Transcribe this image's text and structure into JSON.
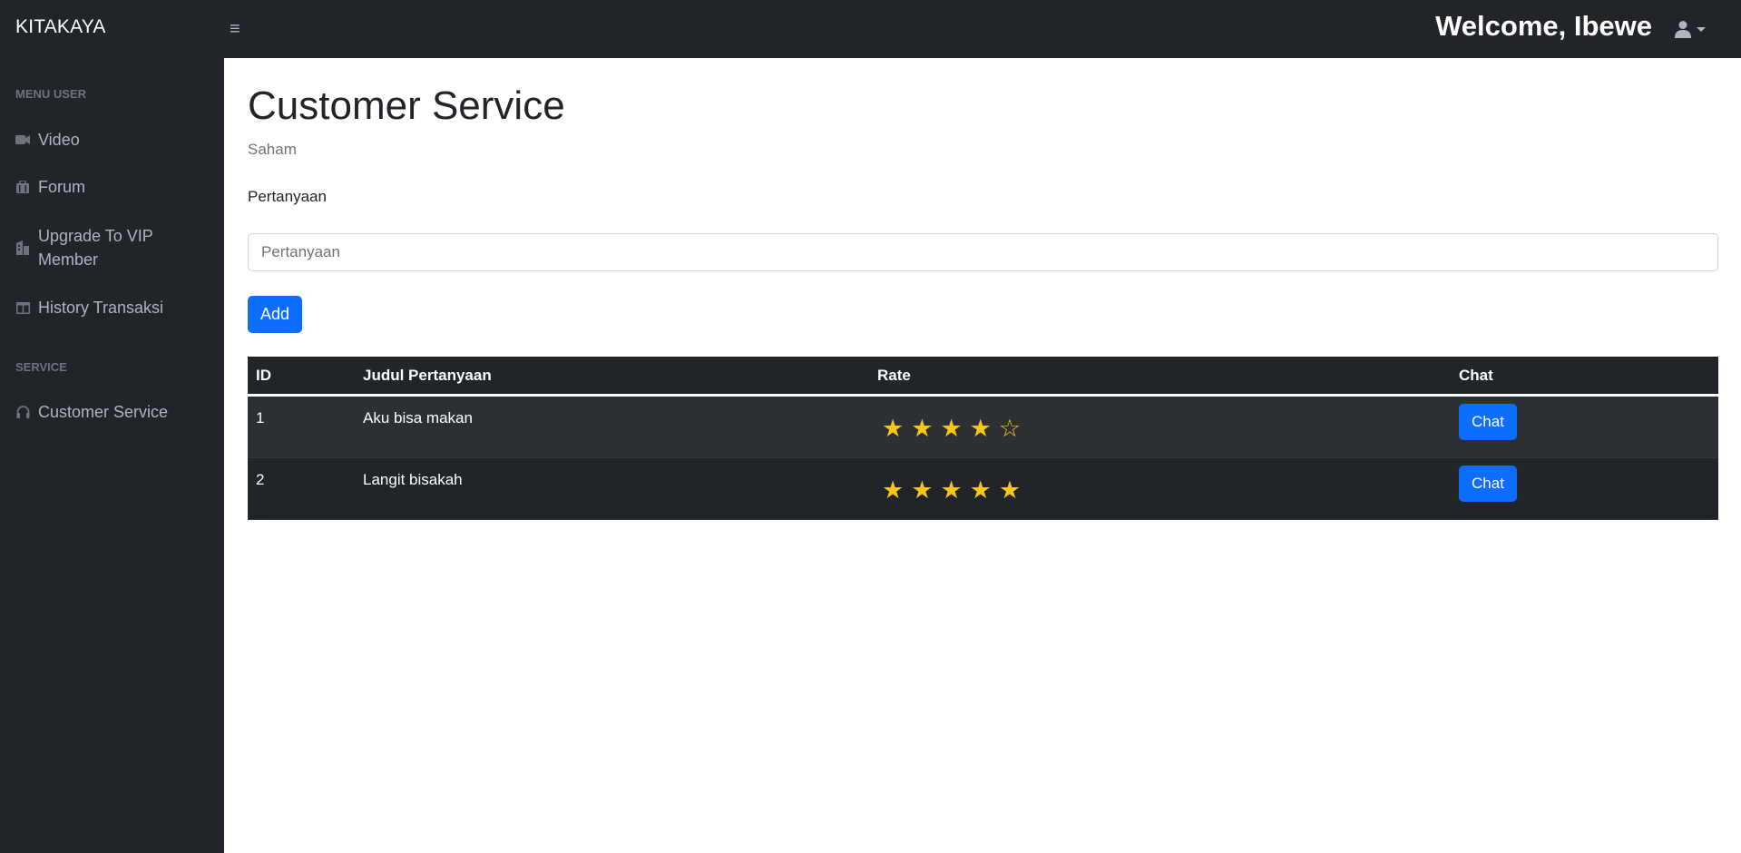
{
  "app": {
    "brand": "KITAKAYA",
    "welcome": "Welcome, Ibewe"
  },
  "sidebar": {
    "sections": [
      {
        "heading": "MENU USER",
        "items": [
          {
            "label": "Video",
            "icon": "video-icon"
          },
          {
            "label": "Forum",
            "icon": "forum-icon"
          },
          {
            "label": "Upgrade To VIP Member",
            "icon": "upgrade-icon"
          },
          {
            "label": "History Transaksi",
            "icon": "table-icon"
          }
        ]
      },
      {
        "heading": "SERVICE",
        "items": [
          {
            "label": "Customer Service",
            "icon": "headset-icon"
          }
        ]
      }
    ]
  },
  "main": {
    "title": "Customer Service",
    "subtitle": "Saham",
    "field_label": "Pertanyaan",
    "input_placeholder": "Pertanyaan",
    "input_value": "",
    "add_label": "Add"
  },
  "table": {
    "columns": [
      "ID",
      "Judul Pertanyaan",
      "Rate",
      "Chat"
    ],
    "rows": [
      {
        "id": "1",
        "title": "Aku bisa makan",
        "rate": 4,
        "rate_max": 5,
        "chat_label": "Chat"
      },
      {
        "id": "2",
        "title": "Langit bisakah",
        "rate": 5,
        "rate_max": 5,
        "chat_label": "Chat"
      }
    ]
  },
  "colors": {
    "sidebar_bg": "#212529",
    "accent": "#0d6efd",
    "star": "#f5c518"
  }
}
